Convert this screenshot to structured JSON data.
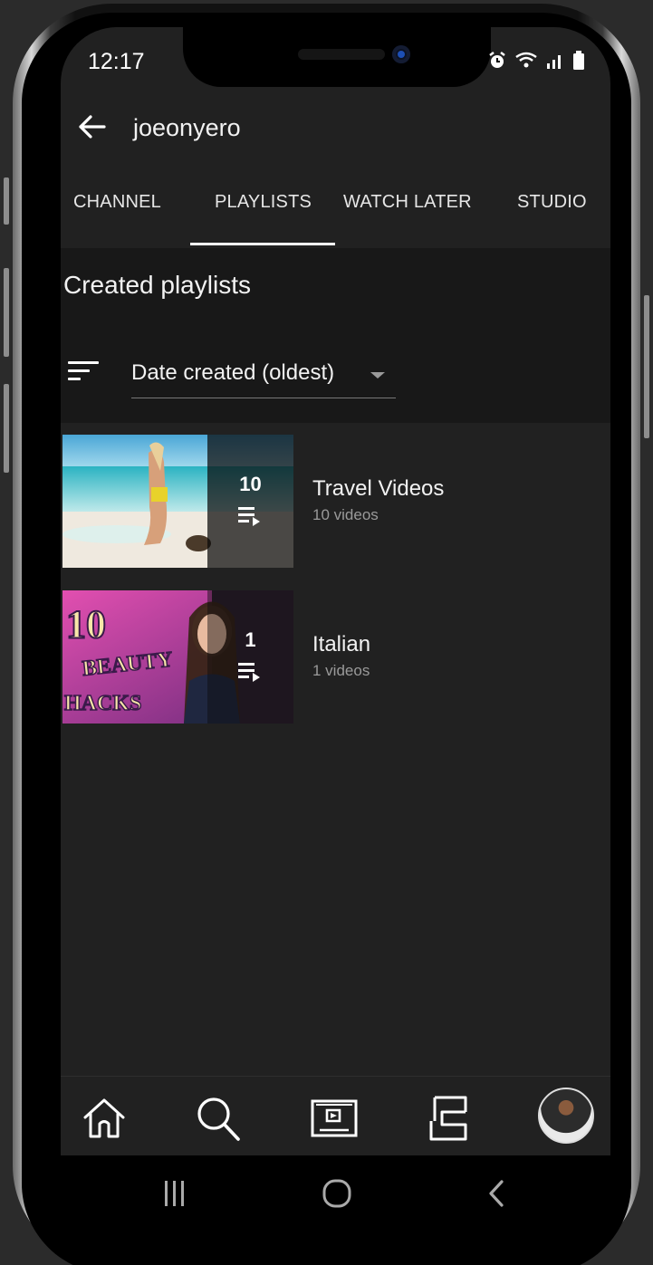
{
  "status_bar": {
    "time": "12:17",
    "icons": [
      "alarm-icon",
      "wifi-icon",
      "signal-icon",
      "battery-icon"
    ]
  },
  "header": {
    "title": "joeonyero",
    "back_icon": "arrow-left-icon"
  },
  "tabs": [
    {
      "label": "CHANNEL",
      "active": false
    },
    {
      "label": "PLAYLISTS",
      "active": true
    },
    {
      "label": "WATCH LATER",
      "active": false
    },
    {
      "label": "STUDIO",
      "active": false
    }
  ],
  "section": {
    "title": "Created playlists",
    "sort_icon": "sort-icon",
    "sort_value": "Date created (oldest)"
  },
  "playlists": [
    {
      "title": "Travel Videos",
      "subtitle": "10 videos",
      "count": "10"
    },
    {
      "title": "Italian",
      "subtitle": "1 videos",
      "count": "1",
      "thumb_text": [
        "10",
        "BEAUTY",
        "HACKS"
      ]
    }
  ],
  "bottom_nav": {
    "items": [
      "home-icon",
      "search-icon",
      "subscriptions-icon",
      "library-icon",
      "avatar"
    ]
  },
  "system_nav": {
    "items": [
      "recents-icon",
      "home-circle-icon",
      "back-chevron-icon"
    ]
  },
  "colors": {
    "background": "#212121",
    "section_background": "#181818",
    "text_primary": "#f2f2f2",
    "text_secondary": "#9a9a9a"
  }
}
